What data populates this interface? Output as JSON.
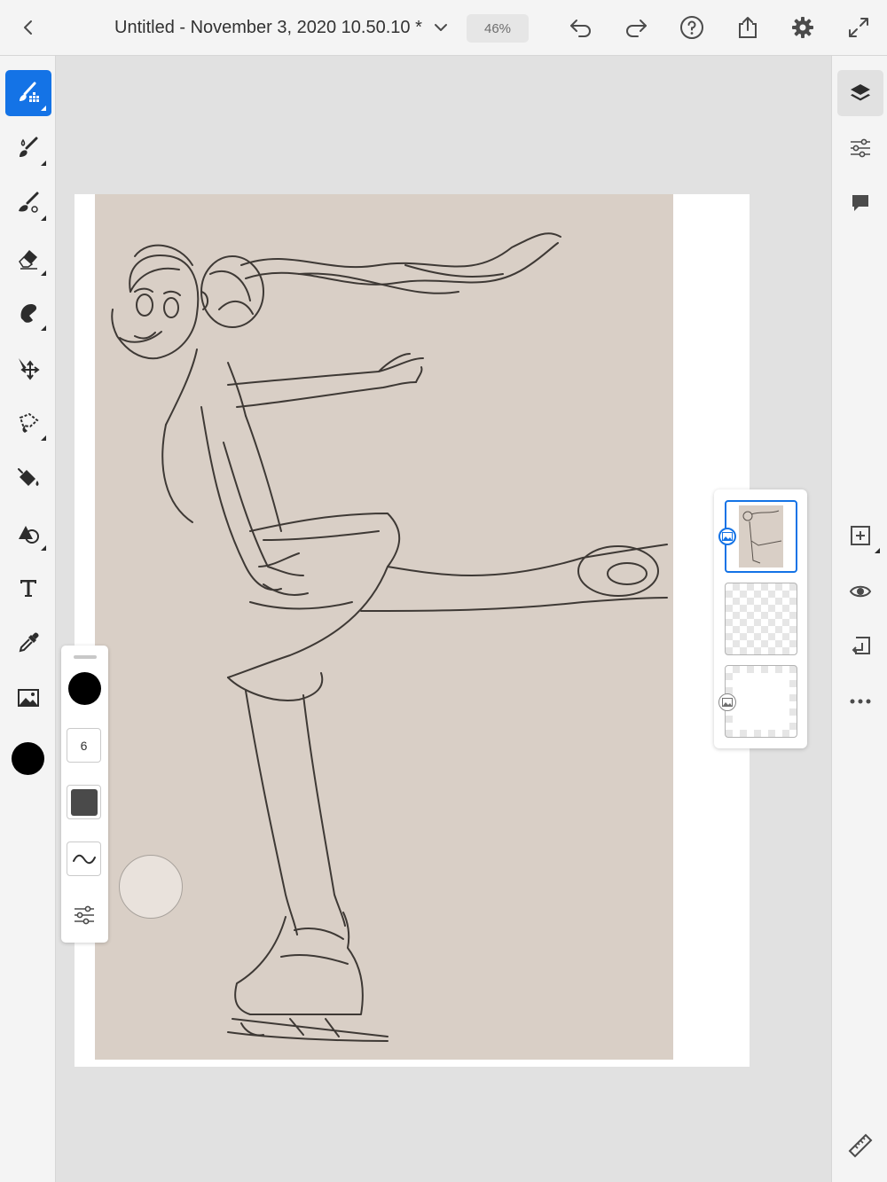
{
  "topbar": {
    "title": "Untitled - November 3, 2020 10.50.10 *",
    "zoom": "46%",
    "icons": [
      "back-icon",
      "chevron-down-icon",
      "undo-icon",
      "redo-icon",
      "help-icon",
      "share-icon",
      "settings-icon",
      "fullscreen-icon"
    ]
  },
  "tools": [
    "pixel-brush",
    "live-brush",
    "vector-brush",
    "eraser",
    "smudge",
    "transform",
    "selection",
    "fill",
    "shapes",
    "text",
    "eyedropper",
    "image"
  ],
  "active_tool": "pixel-brush",
  "current_color": "#000000",
  "brush_panel": {
    "size": "6",
    "color": "#000000"
  },
  "layers": [
    {
      "name": "sketch-photo-layer",
      "selected": true,
      "type": "image"
    },
    {
      "name": "empty-layer",
      "selected": false,
      "type": "pixel"
    },
    {
      "name": "background-layer",
      "selected": false,
      "type": "image"
    }
  ],
  "right_icons": [
    "layers",
    "layer-properties",
    "comments",
    "add-layer",
    "visibility",
    "merge-down",
    "more-options",
    "ruler"
  ],
  "colors": {
    "accent": "#1473e6",
    "panel_bg": "#f4f4f4",
    "canvas_bg": "#e1e1e1",
    "paper": "#d9cfc6"
  }
}
